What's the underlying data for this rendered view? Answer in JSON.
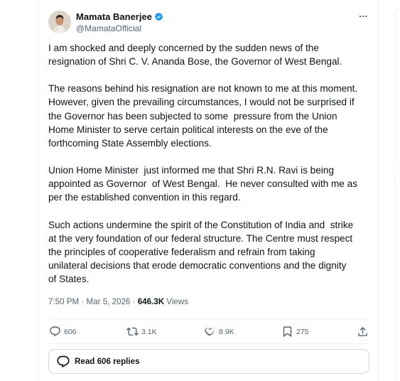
{
  "author": {
    "name": "Mamata Banerjee",
    "handle": "@MamataOfficial"
  },
  "paragraphs": [
    "I am shocked and deeply concerned by the sudden news of the\nresignation of Shri C. V. Ananda Bose, the Governor of West Bengal.",
    "The reasons behind his resignation are not known to me at this moment.\nHowever, given the prevailing circumstances, I would not be surprised if\nthe Governor has been subjected to some  pressure from the Union\nHome Minister to serve certain political interests on the eve of the\nforthcoming State Assembly elections.",
    "Union Home Minister  just informed me that Shri R.N. Ravi is being\nappointed as Governor  of West Bengal.  He never consulted with me as\nper the established convention in this regard.",
    "Such actions undermine the spirit of the Constitution of India and  strike\nat the very foundation of our federal structure. The Centre must respect\nthe principles of cooperative federalism and refrain from taking\nunilateral decisions that erode democratic conventions and the dignity\nof States."
  ],
  "meta": {
    "time": "7:50 PM",
    "separator": " · ",
    "date": "Mar 5, 2026",
    "views_count": "646.3K",
    "views_label": " Views"
  },
  "actions": {
    "replies": "606",
    "reposts": "3.1K",
    "likes": "8.9K",
    "bookmarks": "275"
  },
  "read_replies_label": "Read 606 replies",
  "icons": {
    "verified": "verified-badge-icon",
    "more": "more-icon",
    "reply": "reply-icon",
    "repost": "repost-icon",
    "like": "heart-icon",
    "bookmark": "bookmark-icon",
    "share": "share-icon"
  },
  "colors": {
    "verified_blue": "#1d9bf0",
    "muted": "#536471",
    "text": "#0f1419"
  }
}
